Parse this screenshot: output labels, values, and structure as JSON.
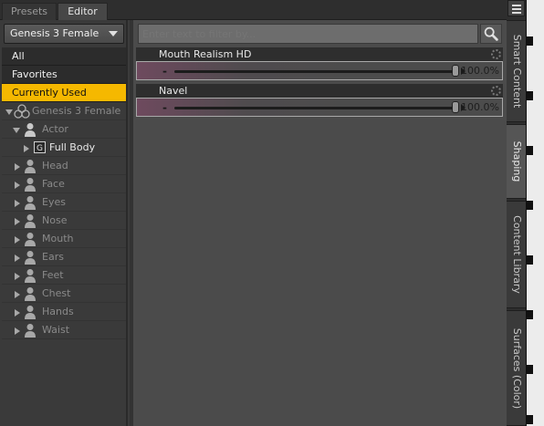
{
  "tabs": {
    "presets": "Presets",
    "editor": "Editor"
  },
  "figure_select": "Genesis 3 Female",
  "filters": [
    "All",
    "Favorites",
    "Currently Used"
  ],
  "tree": {
    "root": "Genesis 3 Female",
    "actor": "Actor",
    "full_body": "Full Body",
    "items": [
      "Head",
      "Face",
      "Eyes",
      "Nose",
      "Mouth",
      "Ears",
      "Feet",
      "Chest",
      "Hands",
      "Waist"
    ]
  },
  "search": {
    "placeholder": "Enter text to filter by..."
  },
  "sliders": [
    {
      "name": "Mouth Realism HD",
      "value": "100.0%",
      "level": 1.0
    },
    {
      "name": "Navel",
      "value": "100.0%",
      "level": 1.0
    }
  ],
  "side_tabs": [
    "Smart Content",
    "Shaping",
    "Content Library",
    "Surfaces (Color)"
  ],
  "colors": {
    "selected": "#f5b800",
    "panel": "#3a3a3a",
    "main": "#4b4b4b"
  }
}
